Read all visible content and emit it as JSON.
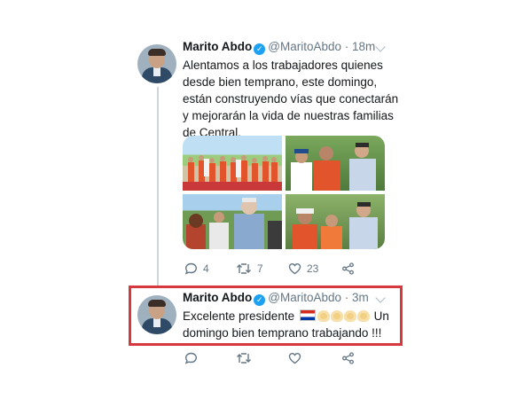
{
  "tweet1": {
    "name": "Marito Abdo",
    "handle": "@MaritoAbdo · 18m",
    "text_lines": [
      "Alentamos a los trabajadores quienes",
      "desde bien temprano, este domingo,",
      "están construyendo vías que conectarán",
      "y mejorarán la vida de nuestras familias",
      "de Central."
    ],
    "replies": "4",
    "retweets": "7",
    "likes": "23"
  },
  "tweet2": {
    "name": "Marito Abdo",
    "handle": "@MaritoAbdo · 3m",
    "text_before": "Excelente presidente",
    "text_after": "Un",
    "text_line2": "domingo bien temprano trabajando !!!"
  },
  "colors": {
    "accent": "#1da1f2",
    "highlight_border": "#d6383d",
    "muted": "#657786"
  },
  "icons": [
    "reply-icon",
    "retweet-icon",
    "like-icon",
    "share-icon",
    "verified-badge-icon",
    "chevron-down-icon"
  ]
}
